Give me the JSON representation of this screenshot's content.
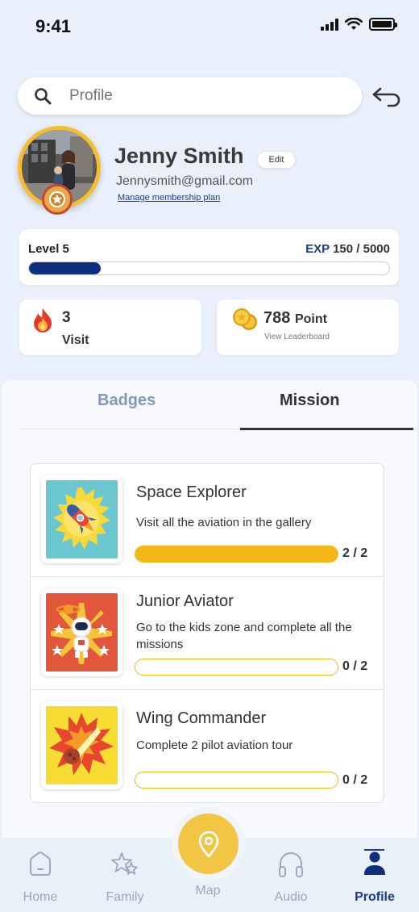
{
  "status": {
    "time": "9:41"
  },
  "search": {
    "placeholder": "Profile"
  },
  "profile": {
    "name": "Jenny Smith",
    "edit_label": "Edit",
    "email": "Jennysmith@gmail.com",
    "manage_link": "Manage membership plan"
  },
  "level": {
    "label": "Level 5",
    "exp_key": "EXP",
    "exp_value": "150 / 5000",
    "progress": 0.2
  },
  "stats": {
    "visit_count": "3",
    "visit_label": "Visit",
    "points": "788",
    "points_unit": "Point",
    "leaderboard_link": "View Leaderboard"
  },
  "tabs": [
    {
      "label": "Badges",
      "active": false
    },
    {
      "label": "Mission",
      "active": true
    }
  ],
  "missions": [
    {
      "title": "Space Explorer",
      "description": "Visit all the aviation in the gallery",
      "count": "2 / 2",
      "progress": 1.0,
      "icon": "rocket-icon"
    },
    {
      "title": "Junior Aviator",
      "description": "Go to the kids zone and complete all the missions",
      "count": "0 / 2",
      "progress": 0,
      "icon": "astronaut-icon"
    },
    {
      "title": "Wing Commander",
      "description": "Complete 2 pilot aviation tour",
      "count": "0 / 2",
      "progress": 0,
      "icon": "comet-icon"
    }
  ],
  "nav": {
    "home": "Home",
    "family": "Family",
    "map": "Map",
    "audio": "Audio",
    "profile": "Profile"
  },
  "colors": {
    "primary": "#0e2f80",
    "accent": "#f3b816",
    "background": "#e9f0fb"
  }
}
